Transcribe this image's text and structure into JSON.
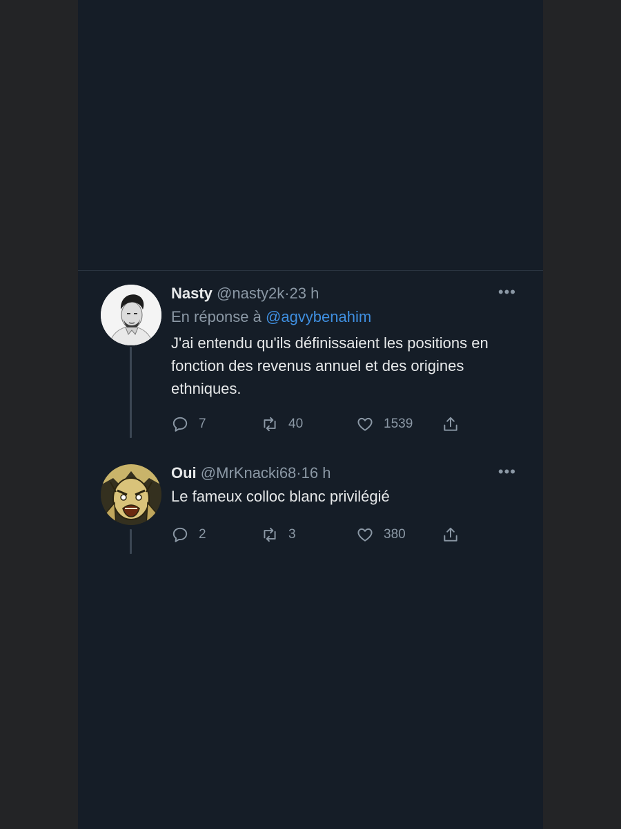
{
  "tweets": [
    {
      "display_name": "Nasty",
      "handle": "@nasty2k",
      "separator": "·",
      "time": "23 h",
      "more": "•••",
      "reply_prefix": "En réponse à",
      "reply_mention": "@agvybenahim",
      "text": "J'ai entendu qu'ils définissaient les positions en fonction des revenus annuel et des origines ethniques.",
      "replies": "7",
      "retweets": "40",
      "likes": "1539"
    },
    {
      "display_name": "Oui",
      "handle": "@MrKnacki68",
      "separator": "·",
      "time": "16 h",
      "more": "•••",
      "text": "Le fameux colloc blanc privilégié",
      "replies": "2",
      "retweets": "3",
      "likes": "380"
    }
  ],
  "icons": {
    "reply": "reply-icon",
    "retweet": "retweet-icon",
    "like": "heart-icon",
    "share": "share-icon"
  },
  "colors": {
    "background": "#151d27",
    "text": "#e7e9ea",
    "secondary": "#8b98a5",
    "link": "#3f8fe0"
  }
}
